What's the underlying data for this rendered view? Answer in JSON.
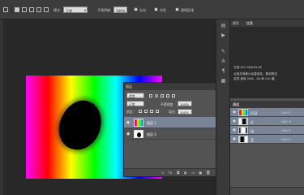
{
  "option_bar": {
    "mode_label": "模式:",
    "mode_value": "正常",
    "opacity_label": "不透明度:",
    "opacity_value": "100%",
    "reverse_label": "反向",
    "dither_label": "仿色",
    "transparency_label": "透明区域"
  },
  "layers_panel": {
    "tab": "图层",
    "filter_value": "类型",
    "blend_value": "正常",
    "opacity_label": "不透明度:",
    "opacity_value": "100%",
    "lock_label": "锁定:",
    "fill_label": "填充:",
    "fill_value": "100%",
    "layers": [
      {
        "name": "图层 1",
        "selected": true
      },
      {
        "name": "图层 0",
        "selected": false
      }
    ]
  },
  "info_panel": {
    "tabs": [
      "颜色",
      "信息"
    ],
    "doc_line": "文档:452.3K/816.4K",
    "hint_line_1": "点按并拖移以创建渐变。要用附加",
    "hint_line_2": "选项,使用 Shift、Alt 和 Ctrl 键。"
  },
  "channels_panel": {
    "tabs": [
      "通道"
    ],
    "channels": [
      {
        "name": "RGB",
        "key": "Ctrl+2",
        "selected": true
      },
      {
        "name": "红",
        "key": "Ctrl+3",
        "selected": true
      },
      {
        "name": "绿",
        "key": "Ctrl+4",
        "selected": true
      },
      {
        "name": "蓝",
        "key": "Ctrl+5",
        "selected": true
      }
    ]
  },
  "colors": {
    "accent_selection": "#7a8497",
    "panel_bg": "#535353",
    "app_bg": "#282828"
  }
}
